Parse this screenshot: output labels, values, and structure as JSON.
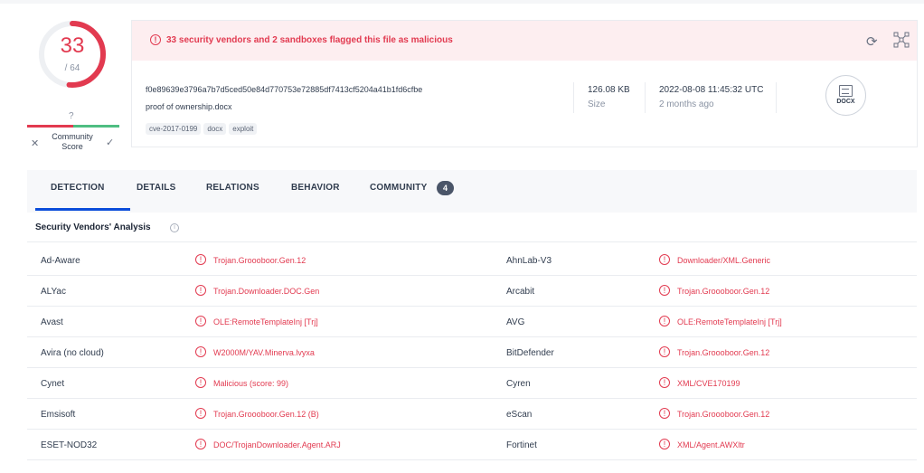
{
  "score": {
    "detections": "33",
    "total": "/ 64",
    "detection_ratio": 0.515625,
    "ring_color": "#e23a50"
  },
  "community": {
    "score_value": "?",
    "label": "Community Score",
    "bad_icon": "x-icon",
    "good_icon": "check-icon"
  },
  "alert": {
    "icon": "exclamation-circle-icon",
    "text": "33 security vendors and 2 sandboxes flagged this file as malicious"
  },
  "actions": {
    "refresh_icon": "refresh-icon",
    "graph_icon": "graph-icon"
  },
  "file": {
    "hash": "f0e89639e3796a7b7d5ced50e84d770753e72885df7413cf5204a41b1fd6cfbe",
    "name": "proof of ownership.docx",
    "tags": [
      "cve-2017-0199",
      "docx",
      "exploit"
    ],
    "size_value": "126.08 KB",
    "size_label": "Size",
    "date_value": "2022-08-08 11:45:32 UTC",
    "date_relative": "2 months ago",
    "type_label": "DOCX"
  },
  "tabs": [
    {
      "label": "DETECTION",
      "active": true
    },
    {
      "label": "DETAILS"
    },
    {
      "label": "RELATIONS"
    },
    {
      "label": "BEHAVIOR"
    },
    {
      "label": "COMMUNITY",
      "badge": "4"
    }
  ],
  "analysis": {
    "title": "Security Vendors' Analysis",
    "rows": [
      {
        "v1": "Ad-Aware",
        "d1": "Trojan.Groooboor.Gen.12",
        "v2": "AhnLab-V3",
        "d2": "Downloader/XML.Generic"
      },
      {
        "v1": "ALYac",
        "d1": "Trojan.Downloader.DOC.Gen",
        "v2": "Arcabit",
        "d2": "Trojan.Groooboor.Gen.12"
      },
      {
        "v1": "Avast",
        "d1": "OLE:RemoteTemplateInj [Trj]",
        "v2": "AVG",
        "d2": "OLE:RemoteTemplateInj [Trj]"
      },
      {
        "v1": "Avira (no cloud)",
        "d1": "W2000M/YAV.Minerva.lvyxa",
        "v2": "BitDefender",
        "d2": "Trojan.Groooboor.Gen.12"
      },
      {
        "v1": "Cynet",
        "d1": "Malicious (score: 99)",
        "v2": "Cyren",
        "d2": "XML/CVE170199"
      },
      {
        "v1": "Emsisoft",
        "d1": "Trojan.Groooboor.Gen.12 (B)",
        "v2": "eScan",
        "d2": "Trojan.Groooboor.Gen.12"
      },
      {
        "v1": "ESET-NOD32",
        "d1": "DOC/TrojanDownloader.Agent.ARJ",
        "v2": "Fortinet",
        "d2": "XML/Agent.AWXltr"
      }
    ]
  }
}
